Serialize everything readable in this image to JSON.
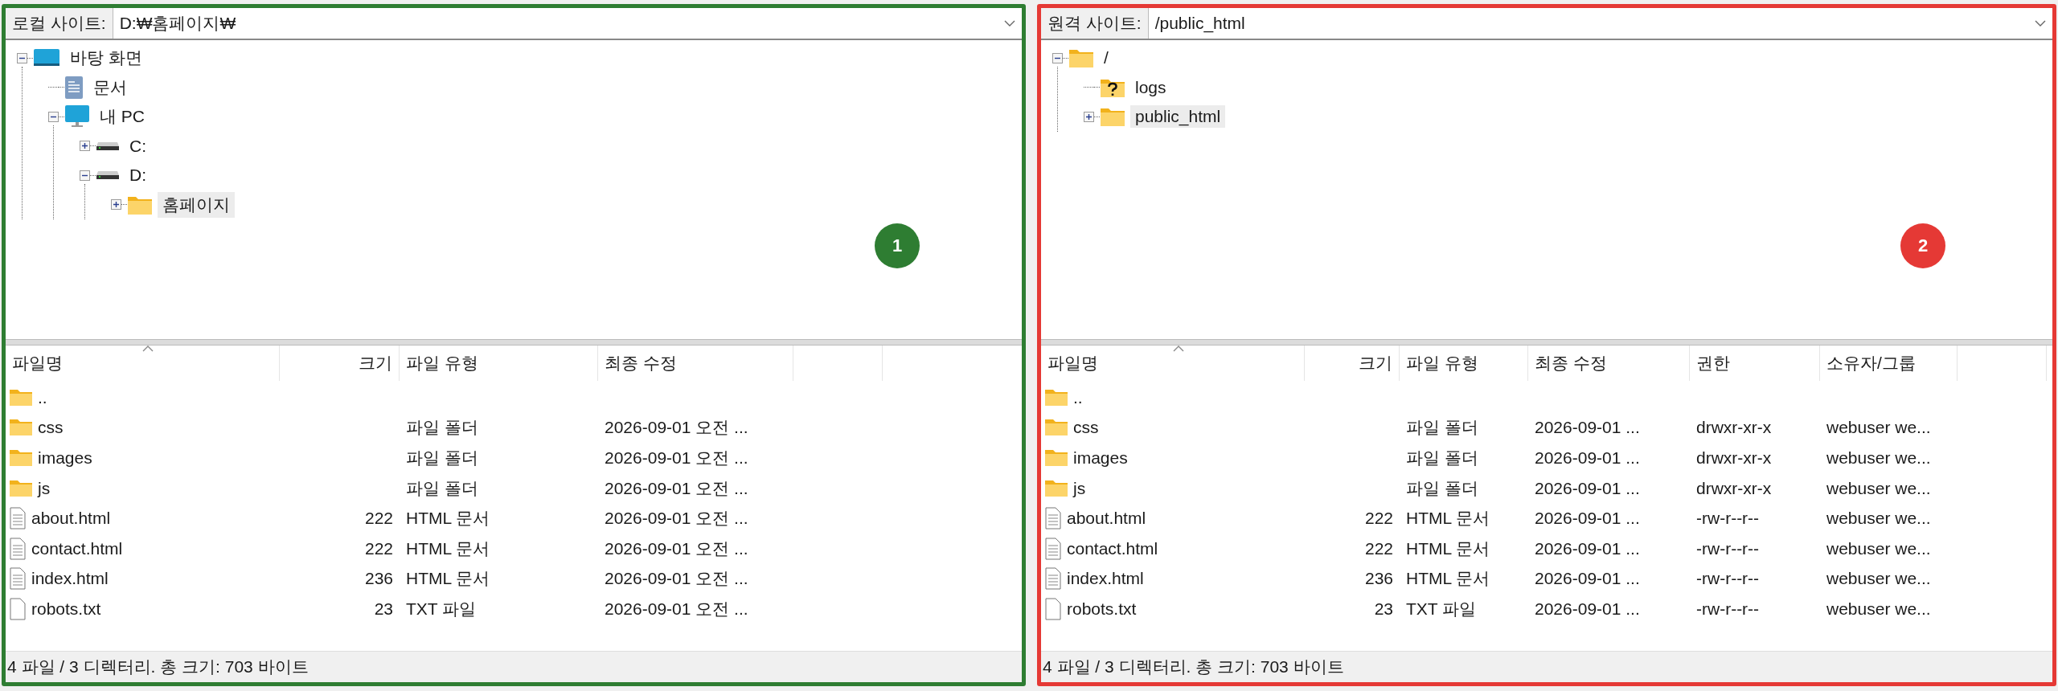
{
  "panels": [
    {
      "color": "#2e7d32",
      "site": {
        "label": "로컬 사이트:",
        "value": "D:₩홈페이지₩"
      },
      "badge": "1",
      "tree": [
        {
          "label": "바탕 화면",
          "kind": "desktop",
          "expanded": true,
          "selected": false,
          "children": [
            {
              "label": "문서",
              "kind": "document",
              "selected": false
            },
            {
              "label": "내 PC",
              "kind": "computer",
              "expanded": true,
              "selected": false,
              "children": [
                {
                  "label": "C:",
                  "kind": "drive",
                  "expanded": false,
                  "selected": false
                },
                {
                  "label": "D:",
                  "kind": "drive",
                  "expanded": true,
                  "selected": false,
                  "children": [
                    {
                      "label": "홈페이지",
                      "kind": "folder",
                      "expanded": false,
                      "selected": true
                    }
                  ]
                }
              ]
            }
          ]
        }
      ],
      "columns": [
        {
          "label": "파일명",
          "sorted": true
        },
        {
          "label": "크기",
          "sorted": false
        },
        {
          "label": "파일 유형",
          "sorted": false
        },
        {
          "label": "최종 수정",
          "sorted": false
        }
      ],
      "rows": [
        {
          "kind": "folder",
          "cells": [
            ".."
          ]
        },
        {
          "kind": "folder",
          "cells": [
            "css",
            null,
            "파일 폴더",
            "2026-09-01 오전 ..."
          ]
        },
        {
          "kind": "folder",
          "cells": [
            "images",
            null,
            "파일 폴더",
            "2026-09-01 오전 ..."
          ]
        },
        {
          "kind": "folder",
          "cells": [
            "js",
            null,
            "파일 폴더",
            "2026-09-01 오전 ..."
          ]
        },
        {
          "kind": "document",
          "cells": [
            "about.html",
            "222",
            "HTML 문서",
            "2026-09-01 오전 ..."
          ]
        },
        {
          "kind": "document",
          "cells": [
            "contact.html",
            "222",
            "HTML 문서",
            "2026-09-01 오전 ..."
          ]
        },
        {
          "kind": "document",
          "cells": [
            "index.html",
            "236",
            "HTML 문서",
            "2026-09-01 오전 ..."
          ]
        },
        {
          "kind": "blank",
          "cells": [
            "robots.txt",
            "23",
            "TXT 파일",
            "2026-09-01 오전 ..."
          ]
        }
      ],
      "status": "4 파일 / 3 디렉터리. 총 크기: 703 바이트"
    },
    {
      "color": "#e53935",
      "site": {
        "label": "원격 사이트:",
        "value": "/public_html"
      },
      "badge": "2",
      "tree": [
        {
          "label": "/",
          "kind": "folder",
          "expanded": true,
          "selected": false,
          "children": [
            {
              "label": "logs",
              "kind": "unknown-folder",
              "selected": false
            },
            {
              "label": "public_html",
              "kind": "folder",
              "expanded": false,
              "selected": true
            }
          ]
        }
      ],
      "columns": [
        {
          "label": "파일명",
          "sorted": true
        },
        {
          "label": "크기",
          "sorted": false
        },
        {
          "label": "파일 유형",
          "sorted": false
        },
        {
          "label": "최종 수정",
          "sorted": false
        },
        {
          "label": "권한",
          "sorted": false
        },
        {
          "label": "소유자/그룹",
          "sorted": false
        }
      ],
      "rows": [
        {
          "kind": "folder",
          "cells": [
            ".."
          ]
        },
        {
          "kind": "folder",
          "cells": [
            "css",
            null,
            "파일 폴더",
            "2026-09-01 ...",
            "drwxr-xr-x",
            "webuser we..."
          ]
        },
        {
          "kind": "folder",
          "cells": [
            "images",
            null,
            "파일 폴더",
            "2026-09-01 ...",
            "drwxr-xr-x",
            "webuser we..."
          ]
        },
        {
          "kind": "folder",
          "cells": [
            "js",
            null,
            "파일 폴더",
            "2026-09-01 ...",
            "drwxr-xr-x",
            "webuser we..."
          ]
        },
        {
          "kind": "document",
          "cells": [
            "about.html",
            "222",
            "HTML 문서",
            "2026-09-01 ...",
            "-rw-r--r--",
            "webuser we..."
          ]
        },
        {
          "kind": "document",
          "cells": [
            "contact.html",
            "222",
            "HTML 문서",
            "2026-09-01 ...",
            "-rw-r--r--",
            "webuser we..."
          ]
        },
        {
          "kind": "document",
          "cells": [
            "index.html",
            "236",
            "HTML 문서",
            "2026-09-01 ...",
            "-rw-r--r--",
            "webuser we..."
          ]
        },
        {
          "kind": "blank",
          "cells": [
            "robots.txt",
            "23",
            "TXT 파일",
            "2026-09-01 ...",
            "-rw-r--r--",
            "webuser we..."
          ]
        }
      ],
      "status": "4 파일 / 3 디렉터리. 총 크기: 703 바이트"
    }
  ]
}
